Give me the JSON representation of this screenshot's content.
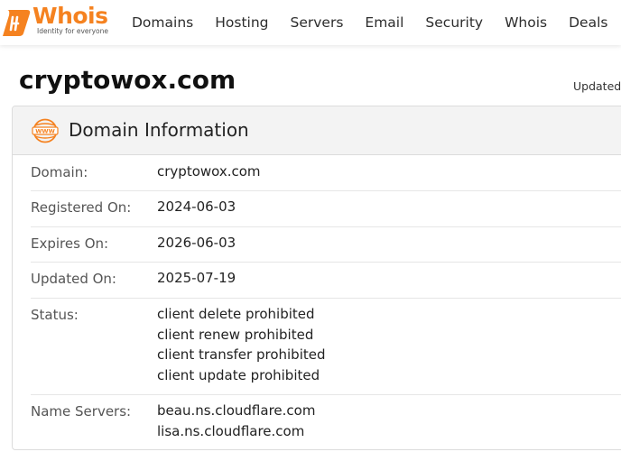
{
  "header": {
    "logo_text": "Whois",
    "logo_tagline": "Identity for everyone",
    "nav": [
      "Domains",
      "Hosting",
      "Servers",
      "Email",
      "Security",
      "Whois",
      "Deals"
    ]
  },
  "page": {
    "title": "cryptowox.com",
    "updated_text": "Updated"
  },
  "panel": {
    "title": "Domain Information",
    "icon": "www-icon",
    "rows": [
      {
        "label": "Domain:",
        "values": [
          "cryptowox.com"
        ]
      },
      {
        "label": "Registered On:",
        "values": [
          "2024-06-03"
        ]
      },
      {
        "label": "Expires On:",
        "values": [
          "2026-06-03"
        ]
      },
      {
        "label": "Updated On:",
        "values": [
          "2025-07-19"
        ]
      },
      {
        "label": "Status:",
        "values": [
          "client delete prohibited",
          "client renew prohibited",
          "client transfer prohibited",
          "client update prohibited"
        ]
      },
      {
        "label": "Name Servers:",
        "values": [
          "beau.ns.cloudflare.com",
          "lisa.ns.cloudflare.com"
        ]
      }
    ]
  },
  "colors": {
    "brand": "#f58220",
    "panel_header_bg": "#f3f3f3"
  }
}
